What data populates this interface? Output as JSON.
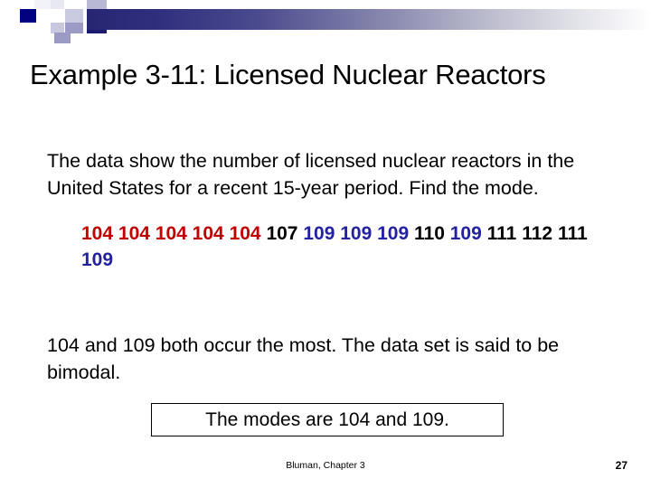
{
  "slide": {
    "title": "Example 3-11: Licensed Nuclear Reactors",
    "prompt": "The data show the number of licensed nuclear reactors in the United States for a recent 15-year period.  Find the mode.",
    "conclusion": "104 and 109 both occur the most.  The data set is said to be bimodal.",
    "answer": "The modes are 104 and 109."
  },
  "colors": {
    "mode_104": "#C00000",
    "mode_109": "#2222A0",
    "plain": "#000000",
    "accent_navy": "#000080",
    "bar_start": "#262673",
    "bar_end": "#FFFFFF"
  },
  "dataset": {
    "values": [
      {
        "text": "104",
        "color_key": "mode_104"
      },
      {
        "text": "104",
        "color_key": "mode_104"
      },
      {
        "text": "104",
        "color_key": "mode_104"
      },
      {
        "text": "104",
        "color_key": "mode_104"
      },
      {
        "text": "104",
        "color_key": "mode_104"
      },
      {
        "text": "107",
        "color_key": "plain"
      },
      {
        "text": "109",
        "color_key": "mode_109"
      },
      {
        "text": "109",
        "color_key": "mode_109"
      },
      {
        "text": "109",
        "color_key": "mode_109"
      },
      {
        "text": "110",
        "color_key": "plain"
      },
      {
        "text": "109",
        "color_key": "mode_109"
      },
      {
        "text": "111",
        "color_key": "plain"
      },
      {
        "text": "112",
        "color_key": "plain"
      },
      {
        "text": "111",
        "color_key": "plain"
      },
      {
        "text": "109",
        "color_key": "mode_109"
      }
    ]
  },
  "footer": {
    "source": "Bluman, Chapter 3",
    "page_number": "27"
  }
}
